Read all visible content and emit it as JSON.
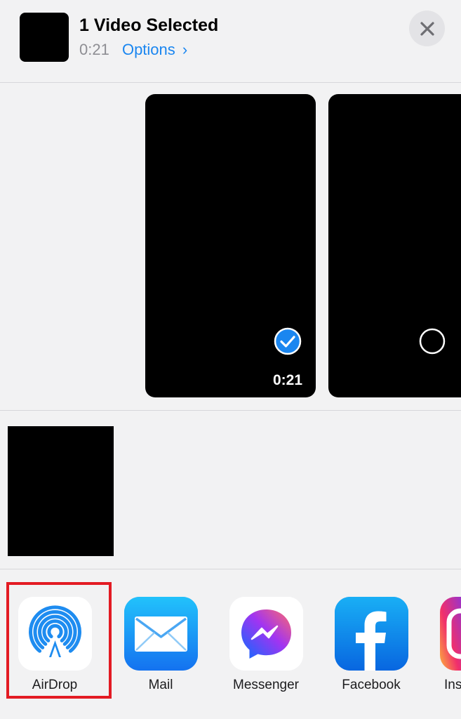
{
  "header": {
    "title": "1 Video Selected",
    "duration": "0:21",
    "options_label": "Options",
    "options_chevron": "›"
  },
  "videos": [
    {
      "selected": true,
      "duration": "0:21"
    },
    {
      "selected": false
    }
  ],
  "apps": [
    {
      "name": "AirDrop",
      "icon": "airdrop-icon",
      "highlighted": true
    },
    {
      "name": "Mail",
      "icon": "mail-icon"
    },
    {
      "name": "Messenger",
      "icon": "messenger-icon"
    },
    {
      "name": "Facebook",
      "icon": "facebook-icon"
    },
    {
      "name": "Ins",
      "icon": "instagram-icon"
    }
  ],
  "colors": {
    "accent": "#1a86f0",
    "highlight_border": "#e31b23",
    "background": "#f2f2f3"
  }
}
